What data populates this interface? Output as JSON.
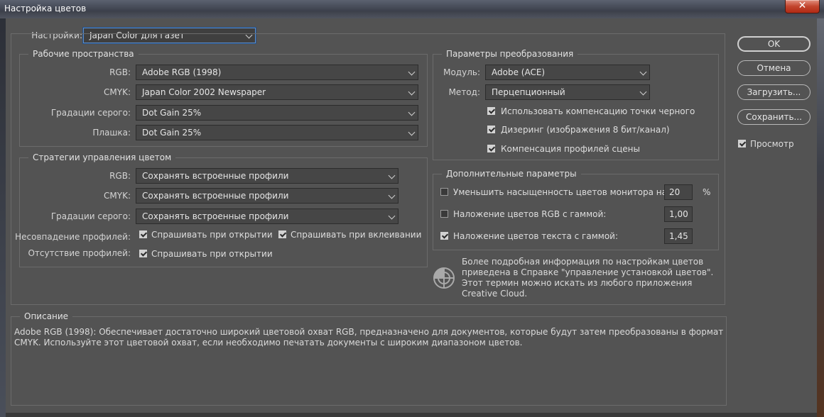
{
  "window": {
    "title": "Настройка цветов",
    "close_glyph": "✕"
  },
  "settings": {
    "label": "Настройки:",
    "value": "Japan Color для газет"
  },
  "working_spaces": {
    "legend": "Рабочие пространства",
    "rgb_label": "RGB:",
    "rgb_value": "Adobe RGB (1998)",
    "cmyk_label": "CMYK:",
    "cmyk_value": "Japan Color 2002 Newspaper",
    "gray_label": "Градации серого:",
    "gray_value": "Dot Gain 25%",
    "spot_label": "Плашка:",
    "spot_value": "Dot Gain 25%"
  },
  "policies": {
    "legend": "Стратегии управления цветом",
    "rgb_label": "RGB:",
    "rgb_value": "Сохранять встроенные профили",
    "cmyk_label": "CMYK:",
    "cmyk_value": "Сохранять встроенные профили",
    "gray_label": "Градации серого:",
    "gray_value": "Сохранять встроенные профили",
    "mismatch_label": "Несовпадение профилей:",
    "mismatch_open": "Спрашивать при открытии",
    "mismatch_paste": "Спрашивать при вклеивании",
    "missing_label": "Отсутствие профилей:",
    "missing_open": "Спрашивать при открытии"
  },
  "conversion": {
    "legend": "Параметры преобразования",
    "engine_label": "Модуль:",
    "engine_value": "Adobe (ACE)",
    "intent_label": "Метод:",
    "intent_value": "Перцепционный",
    "bpc": "Использовать компенсацию точки черного",
    "dither": "Дизеринг (изображения 8 бит/канал)",
    "scene": "Компенсация профилей сцены"
  },
  "advanced": {
    "legend": "Дополнительные параметры",
    "desaturate_label": "Уменьшить насыщенность цветов монитора на:",
    "desaturate_value": "20",
    "desaturate_unit": "%",
    "blend_rgb_label": "Наложение цветов RGB с гаммой:",
    "blend_rgb_value": "1,00",
    "blend_text_label": "Наложение цветов текста с гаммой:",
    "blend_text_value": "1,45"
  },
  "info": {
    "icon": "color-wheel-icon",
    "text": "Более подробная информация по настройкам цветов приведена в Справке \"управление установкой цветов\". Этот термин можно искать из любого приложения Creative Cloud."
  },
  "description": {
    "legend": "Описание",
    "text": "Adobe RGB (1998):  Обеспечивает достаточно широкий цветовой охват RGB, предназначено для документов, которые будут затем преобразованы в формат CMYK. Используйте этот цветовой охват, если необходимо печатать документы с широким диапазоном цветов."
  },
  "buttons": {
    "ok": "OK",
    "cancel": "Отмена",
    "load": "Загрузить...",
    "save": "Сохранить...",
    "preview": "Просмотр"
  }
}
